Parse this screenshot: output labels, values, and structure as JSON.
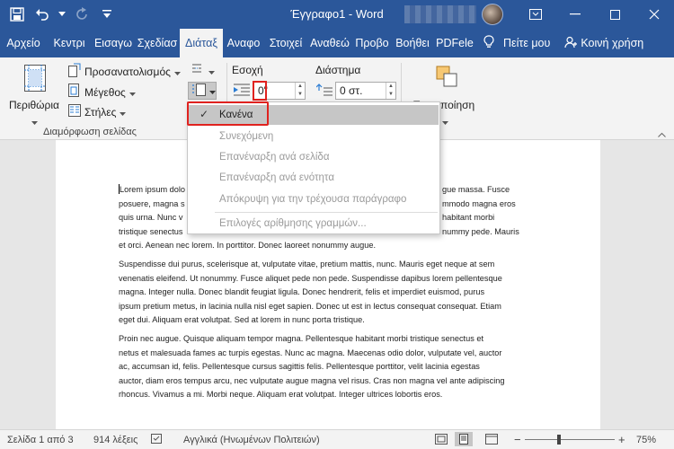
{
  "window": {
    "title": "Έγγραφο1 - Word",
    "colors": {
      "accent": "#2b579a",
      "ribbon_bg": "#f3f3f3",
      "highlight": "#e0221f"
    }
  },
  "quick_access": {
    "icons": [
      "save-icon",
      "undo-icon",
      "redo-icon",
      "customize-qat-icon"
    ]
  },
  "tabs": [
    {
      "label": "Αρχείο",
      "active": false
    },
    {
      "label": "Κεντρι",
      "active": false
    },
    {
      "label": "Εισαγω",
      "active": false
    },
    {
      "label": "Σχεδίασ",
      "active": false
    },
    {
      "label": "Διάταξ",
      "active": true
    },
    {
      "label": "Αναφο",
      "active": false
    },
    {
      "label": "Στοιχεί",
      "active": false
    },
    {
      "label": "Αναθεώ",
      "active": false
    },
    {
      "label": "Προβο",
      "active": false
    },
    {
      "label": "Βοήθει",
      "active": false
    },
    {
      "label": "PDFele",
      "active": false
    }
  ],
  "tell_me": "Πείτε μου",
  "share": "Κοινή χρήση",
  "ribbon": {
    "margins": "Περιθώρια",
    "orientation": "Προσανατολισμός",
    "size": "Μέγεθος",
    "columns": "Στήλες",
    "page_setup_group": "Διαμόρφωση σελίδας",
    "indent_label": "Εσοχή",
    "spacing_label": "Διάστημα",
    "indent_left_value": "0\"",
    "spacing_before_value": "0 στ.",
    "arrange": "Τακτοποίηση"
  },
  "line_numbers_menu": {
    "items": [
      {
        "label": "Κανένα",
        "checked": true
      },
      {
        "label": "Συνεχόμενη",
        "checked": false
      },
      {
        "label": "Επανέναρξη ανά σελίδα",
        "checked": false
      },
      {
        "label": "Επανέναρξη ανά ενότητα",
        "checked": false
      },
      {
        "label": "Απόκρυψη για την τρέχουσα παράγραφο",
        "checked": false
      }
    ],
    "options": "Επιλογές αρίθμησης γραμμών..."
  },
  "document": {
    "p1_left": [
      "Lorem ipsum dolo",
      "posuere, magna s",
      "quis urna. Nunc v",
      "tristique senectus"
    ],
    "p1_right": [
      "gue massa. Fusce",
      "mmodo magna eros",
      "habitant morbi",
      "nummy pede. Mauris"
    ],
    "p1_last": "et orci. Aenean nec lorem. In porttitor. Donec laoreet nonummy augue.",
    "p2": [
      "Suspendisse dui purus, scelerisque at, vulputate vitae, pretium mattis, nunc. Mauris eget neque at sem",
      "venenatis eleifend. Ut nonummy. Fusce aliquet pede non pede. Suspendisse dapibus lorem pellentesque",
      "magna. Integer nulla. Donec blandit feugiat ligula. Donec hendrerit, felis et imperdiet euismod, purus",
      "ipsum pretium metus, in lacinia nulla nisl eget sapien. Donec ut est in lectus consequat consequat. Etiam",
      "eget dui. Aliquam erat volutpat. Sed at lorem in nunc porta tristique."
    ],
    "p3": [
      "Proin nec augue. Quisque aliquam tempor magna. Pellentesque habitant morbi tristique senectus et",
      "netus et malesuada fames ac turpis egestas. Nunc ac magna. Maecenas odio dolor, vulputate vel, auctor",
      "ac, accumsan id, felis. Pellentesque cursus sagittis felis. Pellentesque porttitor, velit lacinia egestas",
      "auctor, diam eros tempus arcu, nec vulputate augue magna vel risus. Cras non magna vel ante adipiscing",
      "rhoncus. Vivamus a mi. Morbi neque. Aliquam erat volutpat. Integer ultrices lobortis eros."
    ]
  },
  "status": {
    "page": "Σελίδα 1 από 3",
    "words": "914 λέξεις",
    "language": "Αγγλικά (Ηνωμένων Πολιτειών)",
    "zoom": "75%",
    "zoom_minus": "−",
    "zoom_plus": "+"
  }
}
